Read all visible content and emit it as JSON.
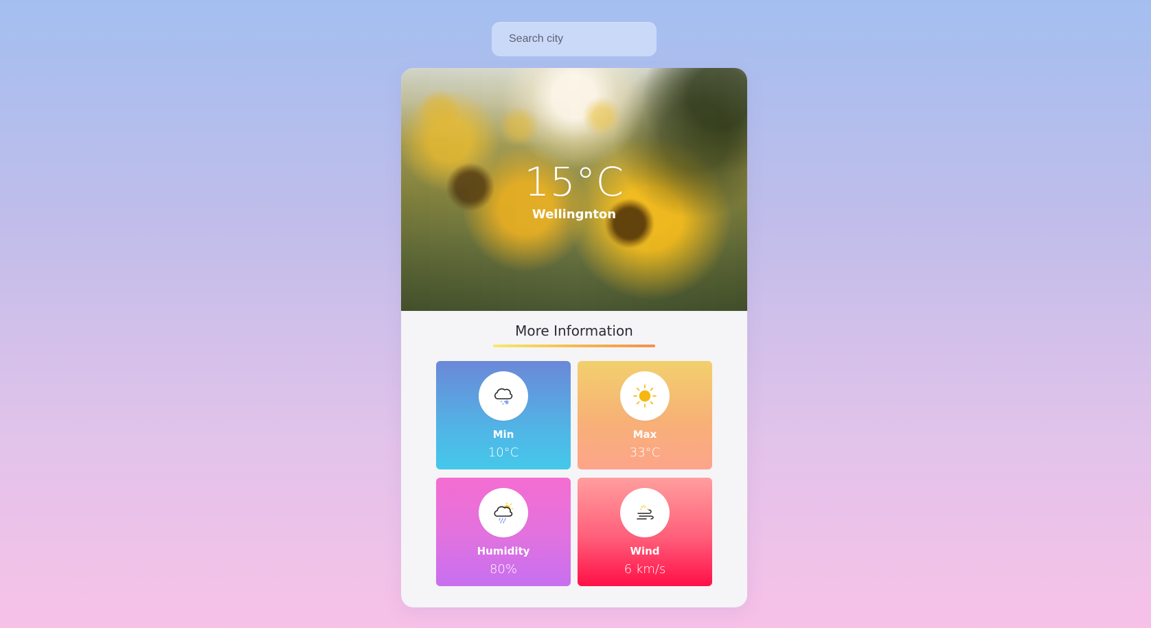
{
  "search": {
    "placeholder": "Search city"
  },
  "weather_card": {
    "current": {
      "temperature": "15°C",
      "city": "Wellingnton"
    },
    "more_information": {
      "title": "More Information",
      "tiles": [
        {
          "label": "Min",
          "value": "10°C",
          "icon": "cloud-snow-icon"
        },
        {
          "label": "Max",
          "value": "33°C",
          "icon": "sun-icon"
        },
        {
          "label": "Humidity",
          "value": "80%",
          "icon": "cloud-rain-sun-icon"
        },
        {
          "label": "Wind",
          "value": "6 km/s",
          "icon": "wind-icon"
        }
      ]
    }
  },
  "colors": {
    "page_gradient": [
      "#a3bff0",
      "#f7c1e8"
    ],
    "card_background": "#f5f4f6",
    "underline_gradient": [
      "#f6ea68",
      "#f4904a"
    ],
    "min_tile": [
      "#6b88d8",
      "#45c8ea"
    ],
    "max_tile": [
      "#f2d06d",
      "#fda48b"
    ],
    "humidity_tile": [
      "#f46dd1",
      "#c76ff0"
    ],
    "wind_tile": [
      "#ff9e9d",
      "#ff0f47"
    ]
  }
}
